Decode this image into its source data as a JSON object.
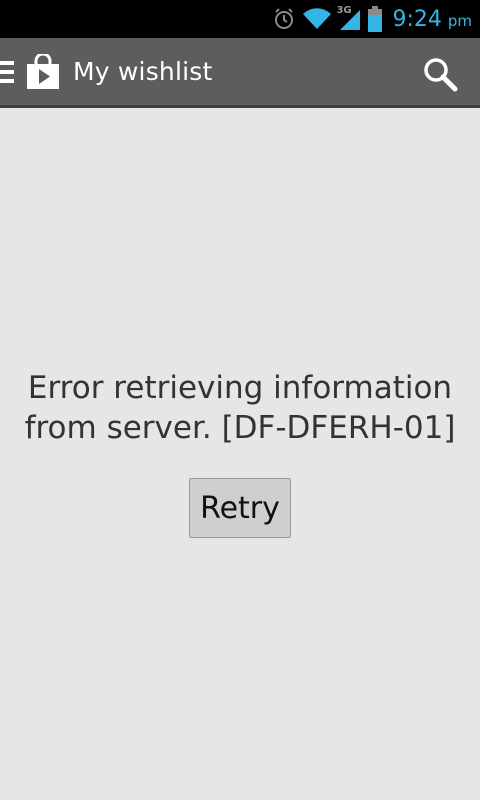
{
  "status_bar": {
    "time": "9:24",
    "ampm": "pm",
    "network_label": "3G",
    "icons": [
      "alarm-icon",
      "wifi-icon",
      "signal-icon",
      "battery-icon"
    ],
    "accent_color": "#33b5e5"
  },
  "action_bar": {
    "title": "My wishlist",
    "icons": [
      "menu-icon",
      "play-store-bag-icon",
      "search-icon"
    ],
    "background": "#5d5d5d"
  },
  "content": {
    "error_line1": "Error retrieving information",
    "error_line2": "from server. [DF-DFERH-01]",
    "retry_label": "Retry"
  }
}
